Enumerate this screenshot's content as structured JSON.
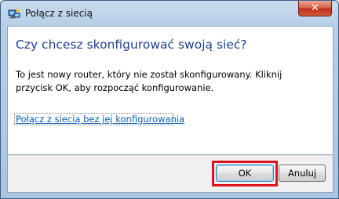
{
  "window": {
    "title": "Połącz z siecią",
    "close_label": "✕"
  },
  "content": {
    "heading": "Czy chcesz skonfigurować swoją sieć?",
    "body": "To jest nowy router, który nie został skonfigurowany. Kliknij przycisk OK, aby rozpocząć konfigurowanie.",
    "link": "Połącz z siecią bez jej konfigurowania"
  },
  "buttons": {
    "ok": "OK",
    "cancel": "Anuluj"
  },
  "colors": {
    "heading": "#1e3f8f",
    "link": "#0a5fb0",
    "highlight": "#e0141e",
    "close_button": "#c1301a"
  }
}
